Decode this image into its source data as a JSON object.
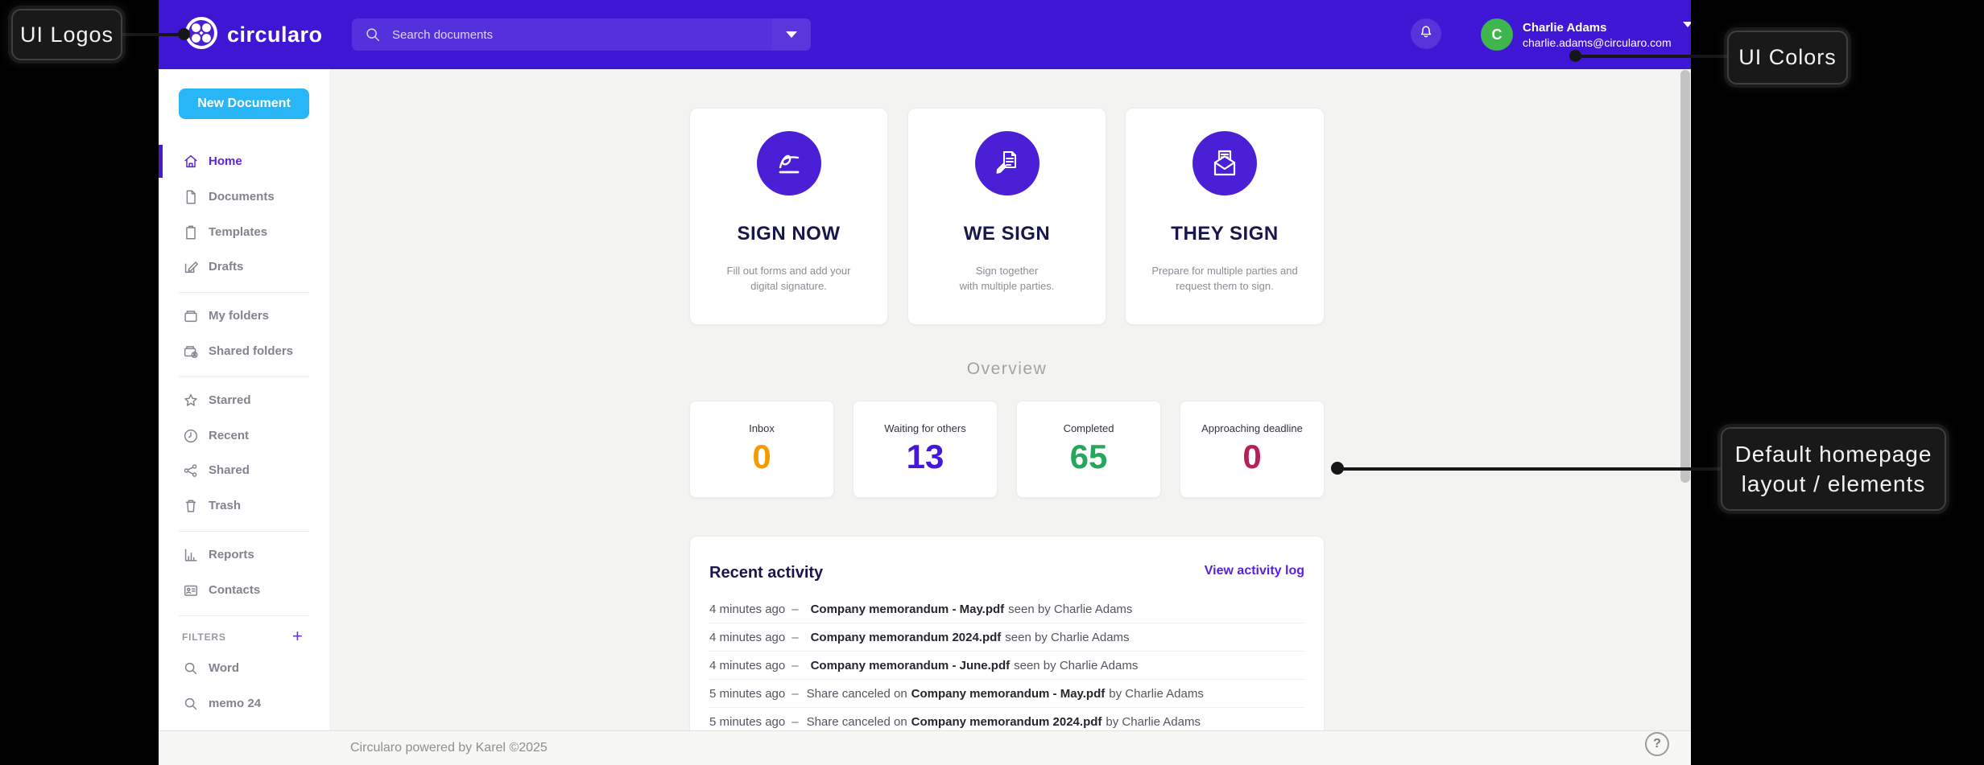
{
  "annotations": {
    "logos_label": "UI Logos",
    "colors_label": "UI Colors",
    "homepage_label_line1": "Default homepage",
    "homepage_label_line2": "layout / elements"
  },
  "header": {
    "brand": "circularo",
    "search_placeholder": "Search documents",
    "user": {
      "avatar_initial": "C",
      "name": "Charlie Adams",
      "email": "charlie.adams@circularo.com"
    }
  },
  "sidebar": {
    "new_document_label": "New Document",
    "nav_main": [
      {
        "label": "Home",
        "icon": "home-icon",
        "active": true
      },
      {
        "label": "Documents",
        "icon": "document-icon"
      },
      {
        "label": "Templates",
        "icon": "template-icon"
      },
      {
        "label": "Drafts",
        "icon": "drafts-icon"
      }
    ],
    "nav_folders": [
      {
        "label": "My folders",
        "icon": "folder-icon"
      },
      {
        "label": "Shared folders",
        "icon": "shared-folder-icon"
      }
    ],
    "nav_collections": [
      {
        "label": "Starred",
        "icon": "star-icon"
      },
      {
        "label": "Recent",
        "icon": "clock-icon"
      },
      {
        "label": "Shared",
        "icon": "share-icon"
      },
      {
        "label": "Trash",
        "icon": "trash-icon"
      }
    ],
    "nav_tools": [
      {
        "label": "Reports",
        "icon": "reports-icon"
      },
      {
        "label": "Contacts",
        "icon": "contacts-icon"
      }
    ],
    "filters": {
      "title": "FILTERS",
      "add_label": "+",
      "items": [
        {
          "label": "Word",
          "icon": "search-icon"
        },
        {
          "label": "memo 24",
          "icon": "search-icon"
        }
      ]
    }
  },
  "cards": [
    {
      "title": "SIGN NOW",
      "icon": "signature-icon",
      "desc_line1": "Fill out forms and add your",
      "desc_line2": "digital signature."
    },
    {
      "title": "WE SIGN",
      "icon": "document-pen-icon",
      "desc_line1": "Sign together",
      "desc_line2": "with multiple parties."
    },
    {
      "title": "THEY SIGN",
      "icon": "envelope-letter-icon",
      "desc_line1": "Prepare for multiple parties and",
      "desc_line2": "request them to sign."
    }
  ],
  "overview": {
    "title": "Overview",
    "stats": [
      {
        "label": "Inbox",
        "value": "0",
        "color": "#f59b00"
      },
      {
        "label": "Waiting for others",
        "value": "13",
        "color": "#4517d9"
      },
      {
        "label": "Completed",
        "value": "65",
        "color": "#24a85b"
      },
      {
        "label": "Approaching deadline",
        "value": "0",
        "color": "#b71f5b"
      }
    ]
  },
  "activity": {
    "title": "Recent activity",
    "link_label": "View activity log",
    "dash": "–",
    "rows": [
      {
        "time": "4 minutes ago",
        "pre": "",
        "doc": "Company memorandum - May.pdf",
        "post": "seen by Charlie Adams"
      },
      {
        "time": "4 minutes ago",
        "pre": "",
        "doc": "Company memorandum 2024.pdf",
        "post": "seen by Charlie Adams"
      },
      {
        "time": "4 minutes ago",
        "pre": "",
        "doc": "Company memorandum - June.pdf",
        "post": "seen by Charlie Adams"
      },
      {
        "time": "5 minutes ago",
        "pre": "Share canceled on",
        "doc": "Company memorandum - May.pdf",
        "post": "by Charlie Adams"
      },
      {
        "time": "5 minutes ago",
        "pre": "Share canceled on",
        "doc": "Company memorandum 2024.pdf",
        "post": "by Charlie Adams"
      }
    ]
  },
  "footer": {
    "text": "Circularo powered by Karel ©2025",
    "help_label": "?"
  },
  "colors": {
    "header_purple": "#3e16d4",
    "search_bar_purple": "#5431dc",
    "accent_purple": "#5b24dd",
    "icon_circle_purple": "#4b1fd6",
    "new_document_blue": "#29b6f6",
    "avatar_green": "#3fb54d",
    "title_navy": "#17174e",
    "stat_orange": "#f59b00",
    "stat_indigo": "#4517d9",
    "stat_green": "#24a85b",
    "stat_crimson": "#b71f5b",
    "content_bg": "#f3f3f1",
    "annotation_bg": "#191919"
  }
}
